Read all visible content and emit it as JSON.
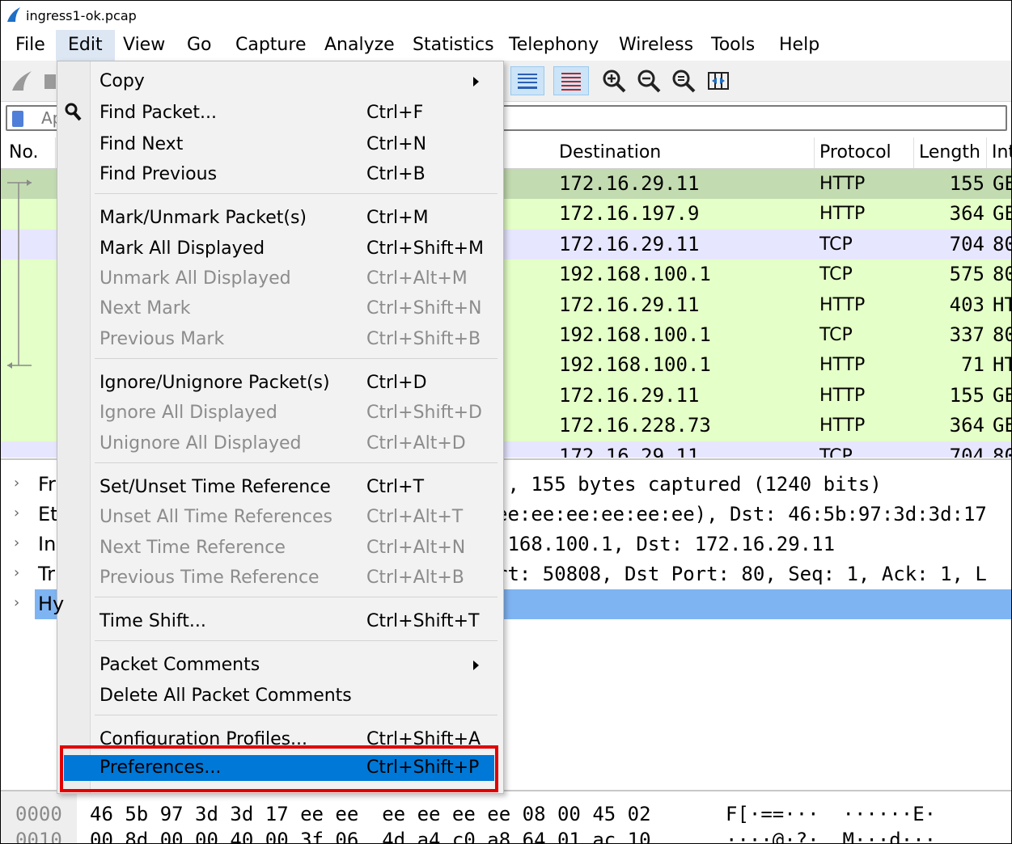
{
  "window": {
    "title": "ingress1-ok.pcap"
  },
  "menubar": [
    "File",
    "Edit",
    "View",
    "Go",
    "Capture",
    "Analyze",
    "Statistics",
    "Telephony",
    "Wireless",
    "Tools",
    "Help"
  ],
  "filter": {
    "placeholder_visible": "Ap"
  },
  "packet_list": {
    "columns": [
      "No.",
      "Destination",
      "Protocol",
      "Length",
      "Int"
    ],
    "rows": [
      {
        "dest": "172.16.29.11",
        "proto": "HTTP",
        "len": "155",
        "info": "GE",
        "bg": "#c3dbb0"
      },
      {
        "dest": "172.16.197.9",
        "proto": "HTTP",
        "len": "364",
        "info": "GE",
        "bg": "#e4ffc7"
      },
      {
        "dest": "172.16.29.11",
        "proto": "TCP",
        "len": "704",
        "info": "80",
        "bg": "#e7e6ff"
      },
      {
        "dest": "192.168.100.1",
        "proto": "TCP",
        "len": "575",
        "info": "80",
        "bg": "#e4ffc7"
      },
      {
        "dest": "172.16.29.11",
        "proto": "HTTP",
        "len": "403",
        "info": "HT",
        "bg": "#e4ffc7"
      },
      {
        "dest": "192.168.100.1",
        "proto": "TCP",
        "len": "337",
        "info": "80",
        "bg": "#e4ffc7"
      },
      {
        "dest": "192.168.100.1",
        "proto": "HTTP",
        "len": "71",
        "info": "HT",
        "bg": "#e4ffc7"
      },
      {
        "dest": "172.16.29.11",
        "proto": "HTTP",
        "len": "155",
        "info": "GE",
        "bg": "#e4ffc7"
      },
      {
        "dest": "172.16.228.73",
        "proto": "HTTP",
        "len": "364",
        "info": "GE",
        "bg": "#e4ffc7"
      },
      {
        "dest": "172.16.29.11",
        "proto": "TCP",
        "len": "704",
        "info": "80",
        "bg": "#e7e6ff"
      }
    ]
  },
  "details": [
    {
      "label": "Fr",
      "text": "), 155 bytes captured (1240 bits)"
    },
    {
      "label": "Et",
      "text": "ee:ee:ee:ee:ee:ee), Dst: 46:5b:97:3d:3d:17"
    },
    {
      "label": "In",
      "text": ".168.100.1, Dst: 172.16.29.11"
    },
    {
      "label": "Tr",
      "text": "rt: 50808, Dst Port: 80, Seq: 1, Ack: 1, L"
    },
    {
      "label": "Hy",
      "text": ""
    }
  ],
  "bytes": [
    {
      "offset": "0000",
      "hex": "46 5b 97 3d 3d 17 ee ee  ee ee ee ee 08 00 45 02",
      "ascii": "F[·==···  ······E·"
    },
    {
      "offset": "0010",
      "hex": "00 8d 00 00 40 00 3f 06  4d a4 c0 a8 64 01 ac 10",
      "ascii": "····@·?·  M···d···"
    }
  ],
  "edit_menu": {
    "items": [
      {
        "label": "Copy",
        "shortcut": "",
        "submenu": true,
        "disabled": false
      },
      {
        "label": "Find Packet...",
        "shortcut": "Ctrl+F",
        "disabled": false
      },
      {
        "label": "Find Next",
        "shortcut": "Ctrl+N",
        "disabled": false
      },
      {
        "label": "Find Previous",
        "shortcut": "Ctrl+B",
        "disabled": false
      },
      {
        "label": "Mark/Unmark Packet(s)",
        "shortcut": "Ctrl+M",
        "disabled": false
      },
      {
        "label": "Mark All Displayed",
        "shortcut": "Ctrl+Shift+M",
        "disabled": false
      },
      {
        "label": "Unmark All Displayed",
        "shortcut": "Ctrl+Alt+M",
        "disabled": true
      },
      {
        "label": "Next Mark",
        "shortcut": "Ctrl+Shift+N",
        "disabled": true
      },
      {
        "label": "Previous Mark",
        "shortcut": "Ctrl+Shift+B",
        "disabled": true
      },
      {
        "label": "Ignore/Unignore Packet(s)",
        "shortcut": "Ctrl+D",
        "disabled": false
      },
      {
        "label": "Ignore All Displayed",
        "shortcut": "Ctrl+Shift+D",
        "disabled": true
      },
      {
        "label": "Unignore All Displayed",
        "shortcut": "Ctrl+Alt+D",
        "disabled": true
      },
      {
        "label": "Set/Unset Time Reference",
        "shortcut": "Ctrl+T",
        "disabled": false
      },
      {
        "label": "Unset All Time References",
        "shortcut": "Ctrl+Alt+T",
        "disabled": true
      },
      {
        "label": "Next Time Reference",
        "shortcut": "Ctrl+Alt+N",
        "disabled": true
      },
      {
        "label": "Previous Time Reference",
        "shortcut": "Ctrl+Alt+B",
        "disabled": true
      },
      {
        "label": "Time Shift...",
        "shortcut": "Ctrl+Shift+T",
        "disabled": false
      },
      {
        "label": "Packet Comments",
        "shortcut": "",
        "submenu": true,
        "disabled": false
      },
      {
        "label": "Delete All Packet Comments",
        "shortcut": "",
        "disabled": false
      },
      {
        "label": "Configuration Profiles...",
        "shortcut": "Ctrl+Shift+A",
        "disabled": false
      },
      {
        "label": "Preferences...",
        "shortcut": "Ctrl+Shift+P",
        "disabled": false,
        "highlighted": true
      }
    ]
  },
  "colors": {
    "highlight": "#0078d7",
    "annotation_box": "#e00000",
    "selected_detail": "#7fb4f3"
  }
}
